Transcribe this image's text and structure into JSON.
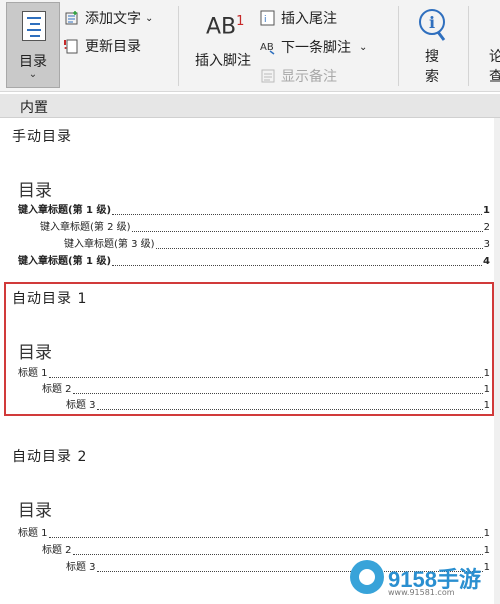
{
  "ribbon": {
    "toc_label": "目录",
    "add_text": "添加文字",
    "update_toc": "更新目录",
    "insert_footnote": "插入脚注",
    "ab_text": "AB",
    "ab_sup": "1",
    "insert_endnote": "插入尾注",
    "next_footnote": "下一条脚注",
    "show_notes": "显示备注",
    "search_line1": "搜",
    "search_line2": "索",
    "partial_line1": "论",
    "partial_line2": "查"
  },
  "gallery": {
    "header": "内置",
    "sections": [
      {
        "title": "手动目录",
        "heading": "目录",
        "entries": [
          {
            "text": "键入章标题(第 1 级)",
            "page": "1",
            "bold": true
          },
          {
            "text": "键入章标题(第 2 级)",
            "page": "2",
            "bold": false
          },
          {
            "text": "键入章标题(第 3 级)",
            "page": "3",
            "bold": false
          },
          {
            "text": "键入章标题(第 1 级)",
            "page": "4",
            "bold": true
          }
        ]
      },
      {
        "title": "自动目录 1",
        "heading": "目录",
        "entries": [
          {
            "text": "标题 1",
            "page": "1"
          },
          {
            "text": "标题 2",
            "page": "1"
          },
          {
            "text": "标题 3",
            "page": "1"
          }
        ]
      },
      {
        "title": "自动目录 2",
        "heading": "目录",
        "entries": [
          {
            "text": "标题 1",
            "page": "1"
          },
          {
            "text": "标题 2",
            "page": "1"
          },
          {
            "text": "标题 3",
            "page": "1"
          }
        ]
      }
    ]
  },
  "watermark": {
    "brand": "9158手游",
    "url": "www.91581.com"
  },
  "colors": {
    "highlight": "#d13a3a",
    "accent_blue": "#2f6fbe",
    "footnote_red": "#c62828"
  }
}
